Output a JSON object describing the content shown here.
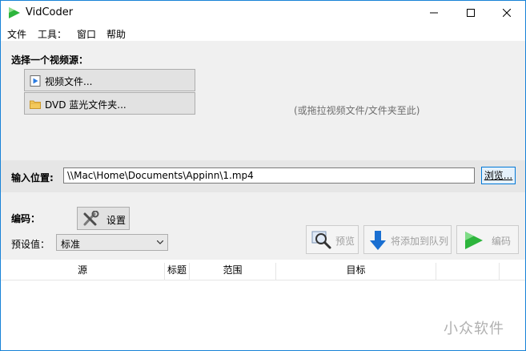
{
  "window": {
    "title": "VidCoder",
    "icon": "vidcoder-logo-icon",
    "controls": [
      "minimize-icon",
      "maximize-icon",
      "close-icon"
    ]
  },
  "menu": {
    "items": [
      "文件",
      "工具：",
      "窗口",
      "帮助"
    ]
  },
  "source": {
    "heading": "选择一个视频源：",
    "video_file_label": "视频文件...",
    "dvd_label": "DVD 蓝光文件夹...",
    "drop_hint": "(或拖拉视频文件/文件夹至此)"
  },
  "input": {
    "label": "输入位置:",
    "path": "\\\\Mac\\Home\\Documents\\Appinn\\1.mp4",
    "browse_label": "浏览..."
  },
  "encode": {
    "heading": "编码：",
    "settings_label": "设置",
    "preset_label": "预设值：",
    "preset_value": "标准",
    "preview_label": "预览",
    "queue_label": "将添加到队列",
    "encode_label": "编码"
  },
  "queue": {
    "columns": [
      "源",
      "标题",
      "范围",
      "目标"
    ]
  },
  "watermark": "小众软件",
  "colors": {
    "window_border": "#1883d7",
    "accent_green": "#2db53c",
    "queue_arrow_blue": "#1a6fd1"
  }
}
